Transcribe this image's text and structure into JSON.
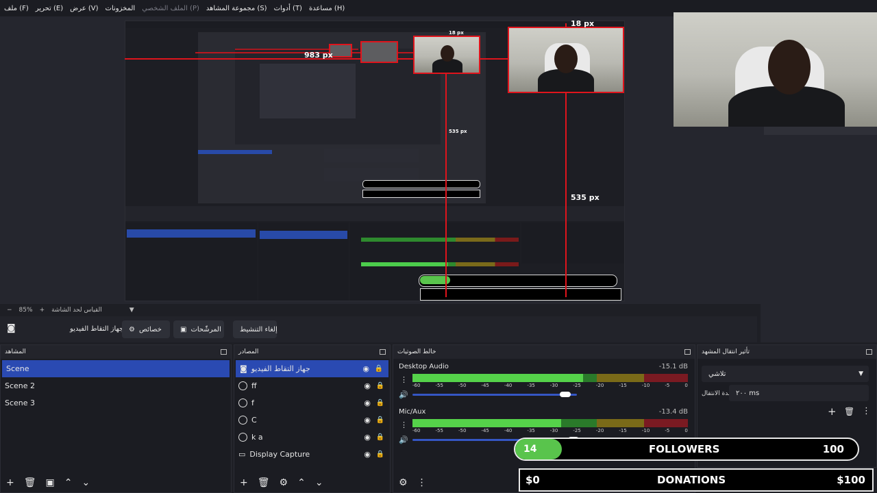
{
  "menu": [
    "ملف (F)",
    "تحرير (E)",
    "عرض (V)",
    "المخزونات",
    "الملف الشخصي (P)",
    "مجموعة المشاهد (S)",
    "أدوات (T)",
    "مساعدة (H)"
  ],
  "preview": {
    "measure_top_right": "18 px",
    "measure_left": "983 px",
    "measure_down": "535 px",
    "measure_top_small": "18 px",
    "measure_down_small": "535 px"
  },
  "zoom": {
    "value": "85%",
    "label": "القياس لحد الشاشة"
  },
  "controls": {
    "source_name": "جهاز التقاط الفيديو",
    "properties": "خصائص",
    "filters": "المرشّحات",
    "deactivate": "إلغاء التنشيط"
  },
  "scenes": {
    "title": "المشاهد",
    "items": [
      "Scene",
      "Scene 2",
      "Scene 3"
    ]
  },
  "sources": {
    "title": "المصادر",
    "items": [
      "جهاز التقاط الفيديو",
      "ff",
      "f",
      "C",
      "k a",
      "Display Capture"
    ]
  },
  "mixer": {
    "title": "خالط الصوتيات",
    "tracks": [
      {
        "name": "Desktop Audio",
        "db": "-15.1 dB",
        "level": 0.62,
        "volume": 0.93
      },
      {
        "name": "Mic/Aux",
        "db": "-13.4 dB",
        "level": 0.54,
        "volume": 0.98
      }
    ],
    "ticks": [
      "-60",
      "-55",
      "-50",
      "-45",
      "-40",
      "-35",
      "-30",
      "-25",
      "-20",
      "-15",
      "-10",
      "-5",
      "0"
    ]
  },
  "transitions": {
    "title": "تأثير انتقال المشهد",
    "type": "تلاشي",
    "duration_label": "مدة الانتقال",
    "duration_value": "٢٠٠ ms"
  },
  "followers": {
    "current": "14",
    "label": "FOLLOWERS",
    "goal": "100"
  },
  "donations": {
    "current": "$0",
    "label": "DONATIONS",
    "goal": "$100"
  },
  "colors": {
    "accent": "#2a4ab2",
    "red_guide": "#e0141c",
    "followers_fill": "#59c44c"
  }
}
